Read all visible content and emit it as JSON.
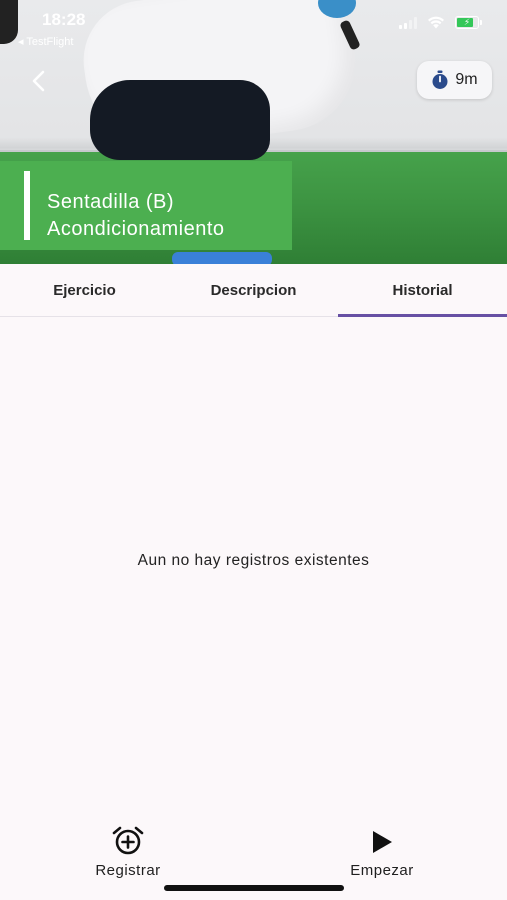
{
  "status_bar": {
    "time": "18:28",
    "back_app": "◂ TestFlight"
  },
  "header": {
    "timer_label": "9m",
    "exercise_name": "Sentadilla (B)",
    "exercise_category": "Acondicionamiento",
    "accent_color": "#4caf50"
  },
  "tabs": [
    {
      "label": "Ejercicio",
      "active": false
    },
    {
      "label": "Descripcion",
      "active": false
    },
    {
      "label": "Historial",
      "active": true
    }
  ],
  "history": {
    "empty_message": "Aun no hay registros existentes"
  },
  "bottom_actions": {
    "register_label": "Registrar",
    "register_icon": "alarm-add-icon",
    "start_label": "Empezar",
    "start_icon": "play-icon"
  },
  "colors": {
    "tab_indicator": "#6750a4",
    "background": "#fcf8fa"
  }
}
